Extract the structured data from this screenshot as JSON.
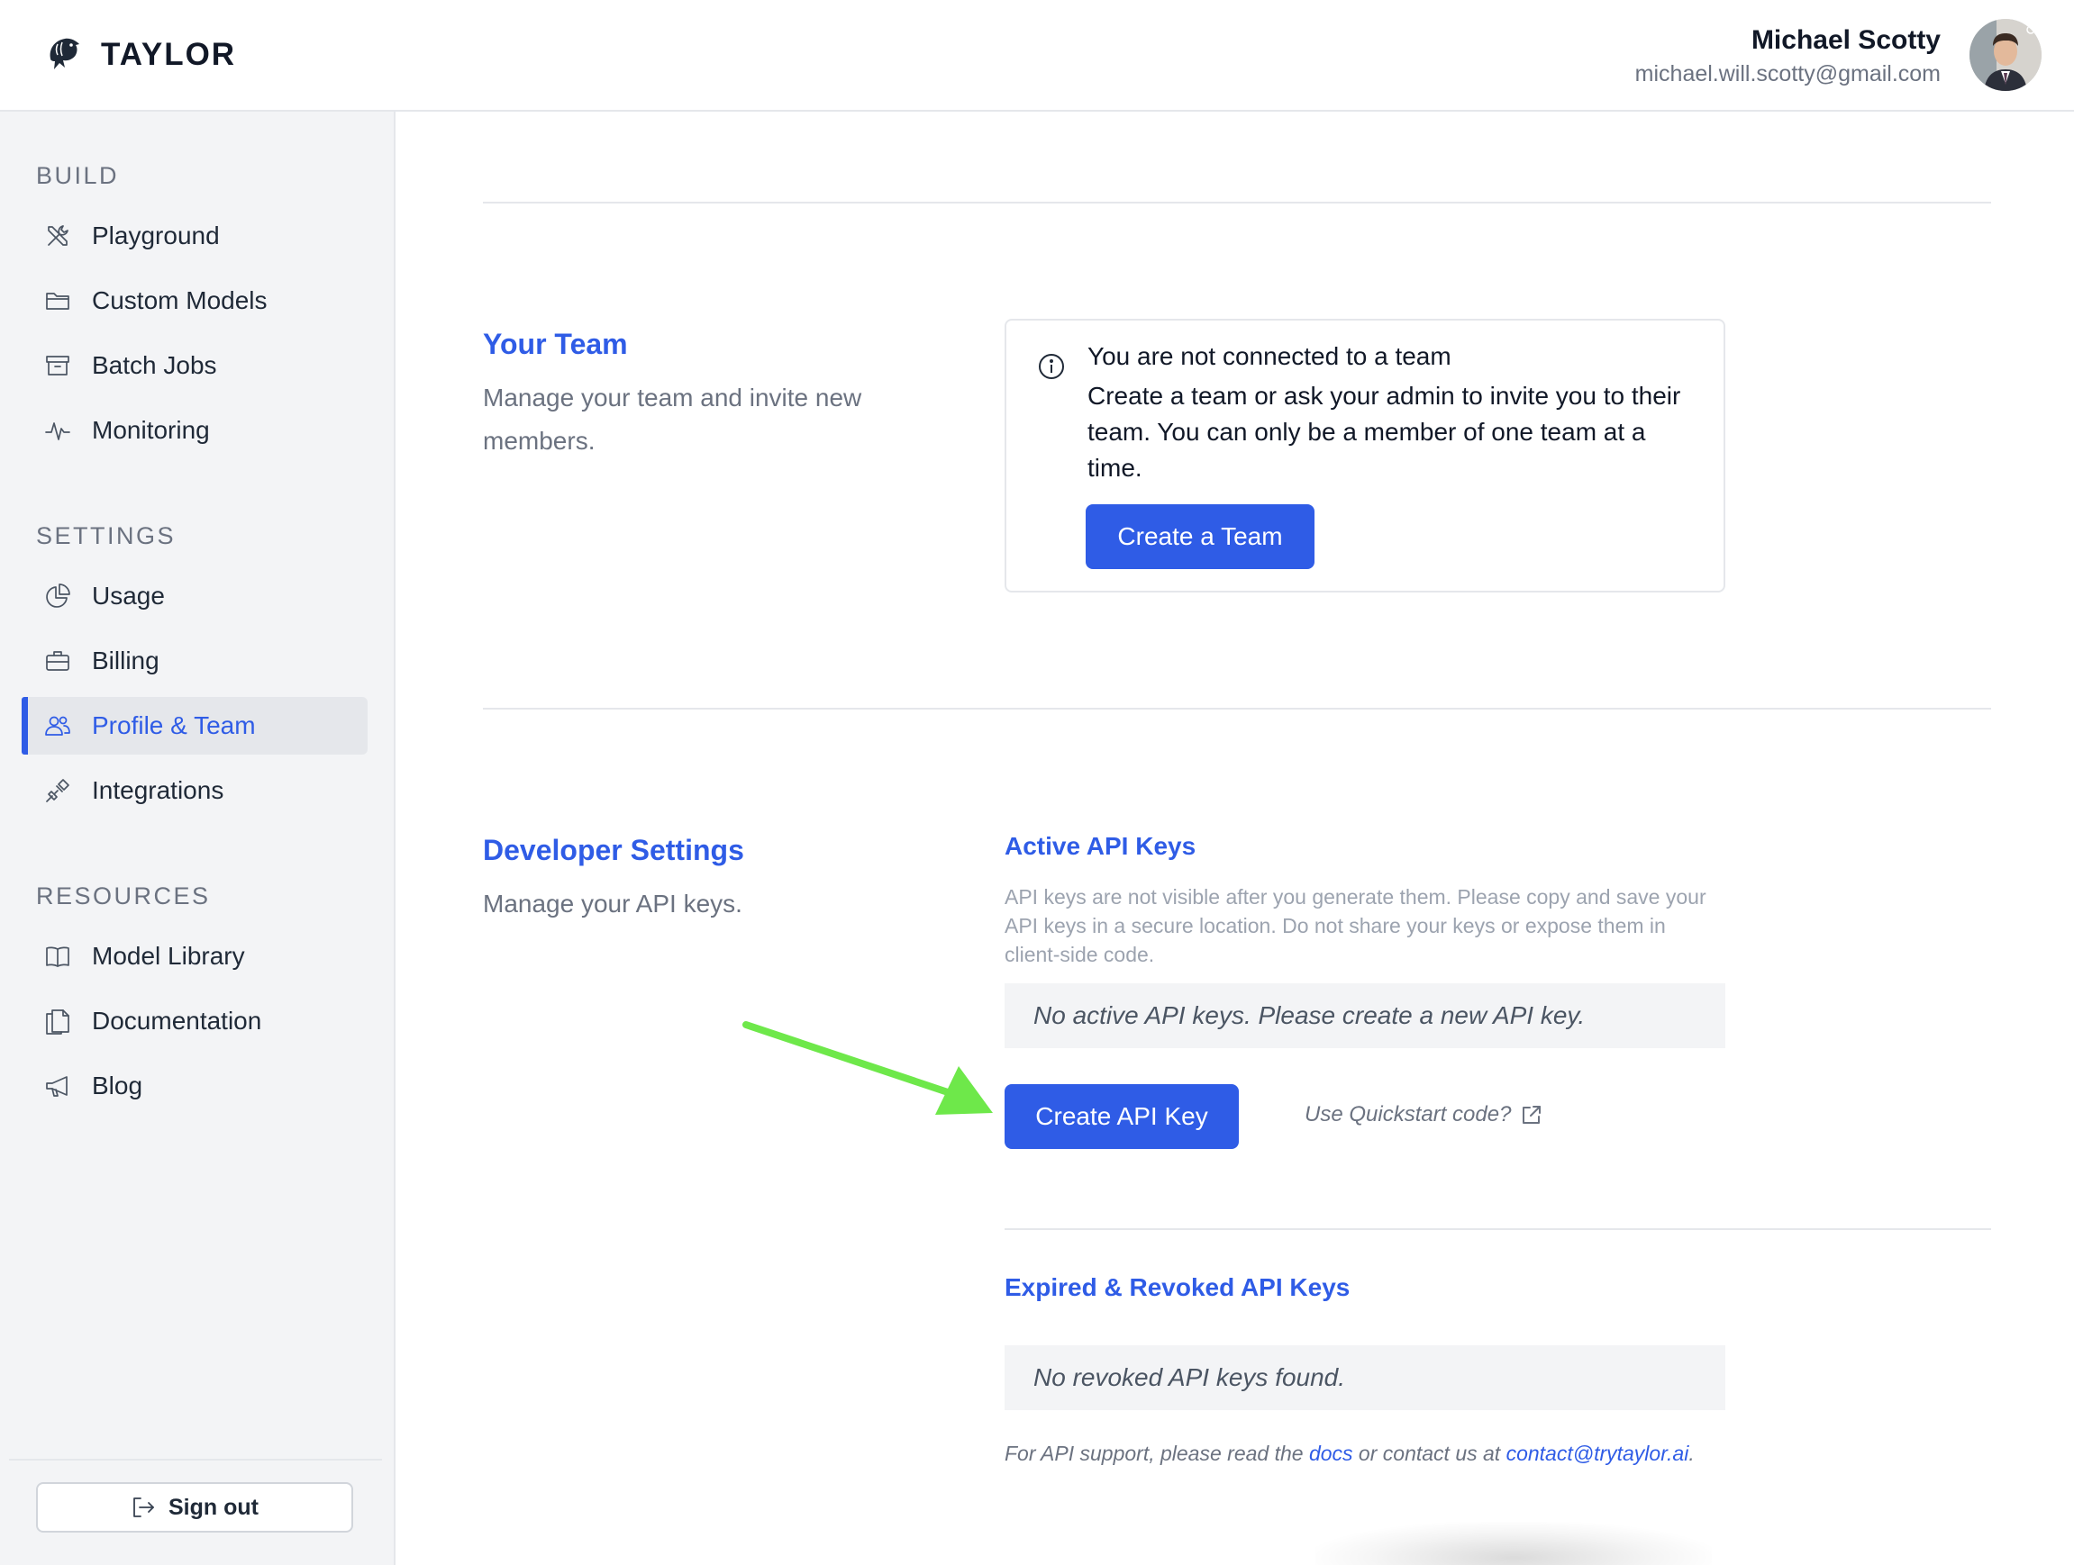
{
  "brand": {
    "name": "TAYLOR",
    "logo_icon": "dolphin-icon"
  },
  "user": {
    "name": "Michael Scotty",
    "email": "michael.will.scotty@gmail.com"
  },
  "sidebar": {
    "sections": [
      {
        "title": "BUILD",
        "items": [
          {
            "label": "Playground",
            "icon": "tools-icon"
          },
          {
            "label": "Custom Models",
            "icon": "folder-icon"
          },
          {
            "label": "Batch Jobs",
            "icon": "archive-icon"
          },
          {
            "label": "Monitoring",
            "icon": "pulse-icon"
          }
        ]
      },
      {
        "title": "SETTINGS",
        "items": [
          {
            "label": "Usage",
            "icon": "pie-chart-icon"
          },
          {
            "label": "Billing",
            "icon": "briefcase-icon"
          },
          {
            "label": "Profile & Team",
            "icon": "users-icon",
            "active": true
          },
          {
            "label": "Integrations",
            "icon": "plug-icon"
          }
        ]
      },
      {
        "title": "RESOURCES",
        "items": [
          {
            "label": "Model Library",
            "icon": "book-icon"
          },
          {
            "label": "Documentation",
            "icon": "documents-icon"
          },
          {
            "label": "Blog",
            "icon": "megaphone-icon"
          }
        ]
      }
    ],
    "signout_label": "Sign out"
  },
  "team": {
    "title": "Your Team",
    "description": "Manage your team and invite new members.",
    "notice_title": "You are not connected to a team",
    "notice_body": "Create a team or ask your admin to invite you to their team. You can only be a member of one team at a time.",
    "create_button": "Create a Team"
  },
  "developer": {
    "title": "Developer Settings",
    "description": "Manage your API keys.",
    "active_keys_title": "Active API Keys",
    "active_keys_desc": "API keys are not visible after you generate them. Please copy and save your API keys in a secure location. Do not share your keys or expose them in client-side code.",
    "active_keys_empty": "No active API keys. Please create a new API key.",
    "create_key_button": "Create API Key",
    "quickstart_link": "Use Quickstart code?",
    "revoked_keys_title": "Expired & Revoked API Keys",
    "revoked_keys_empty": "No revoked API keys found.",
    "support_prefix": "For API support, please read the ",
    "support_docs_link": "docs",
    "support_middle": " or contact us at ",
    "support_email": "contact@trytaylor.ai",
    "support_suffix": "."
  },
  "colors": {
    "accent": "#2f5ce6",
    "annotation_arrow": "#6ee84a"
  }
}
